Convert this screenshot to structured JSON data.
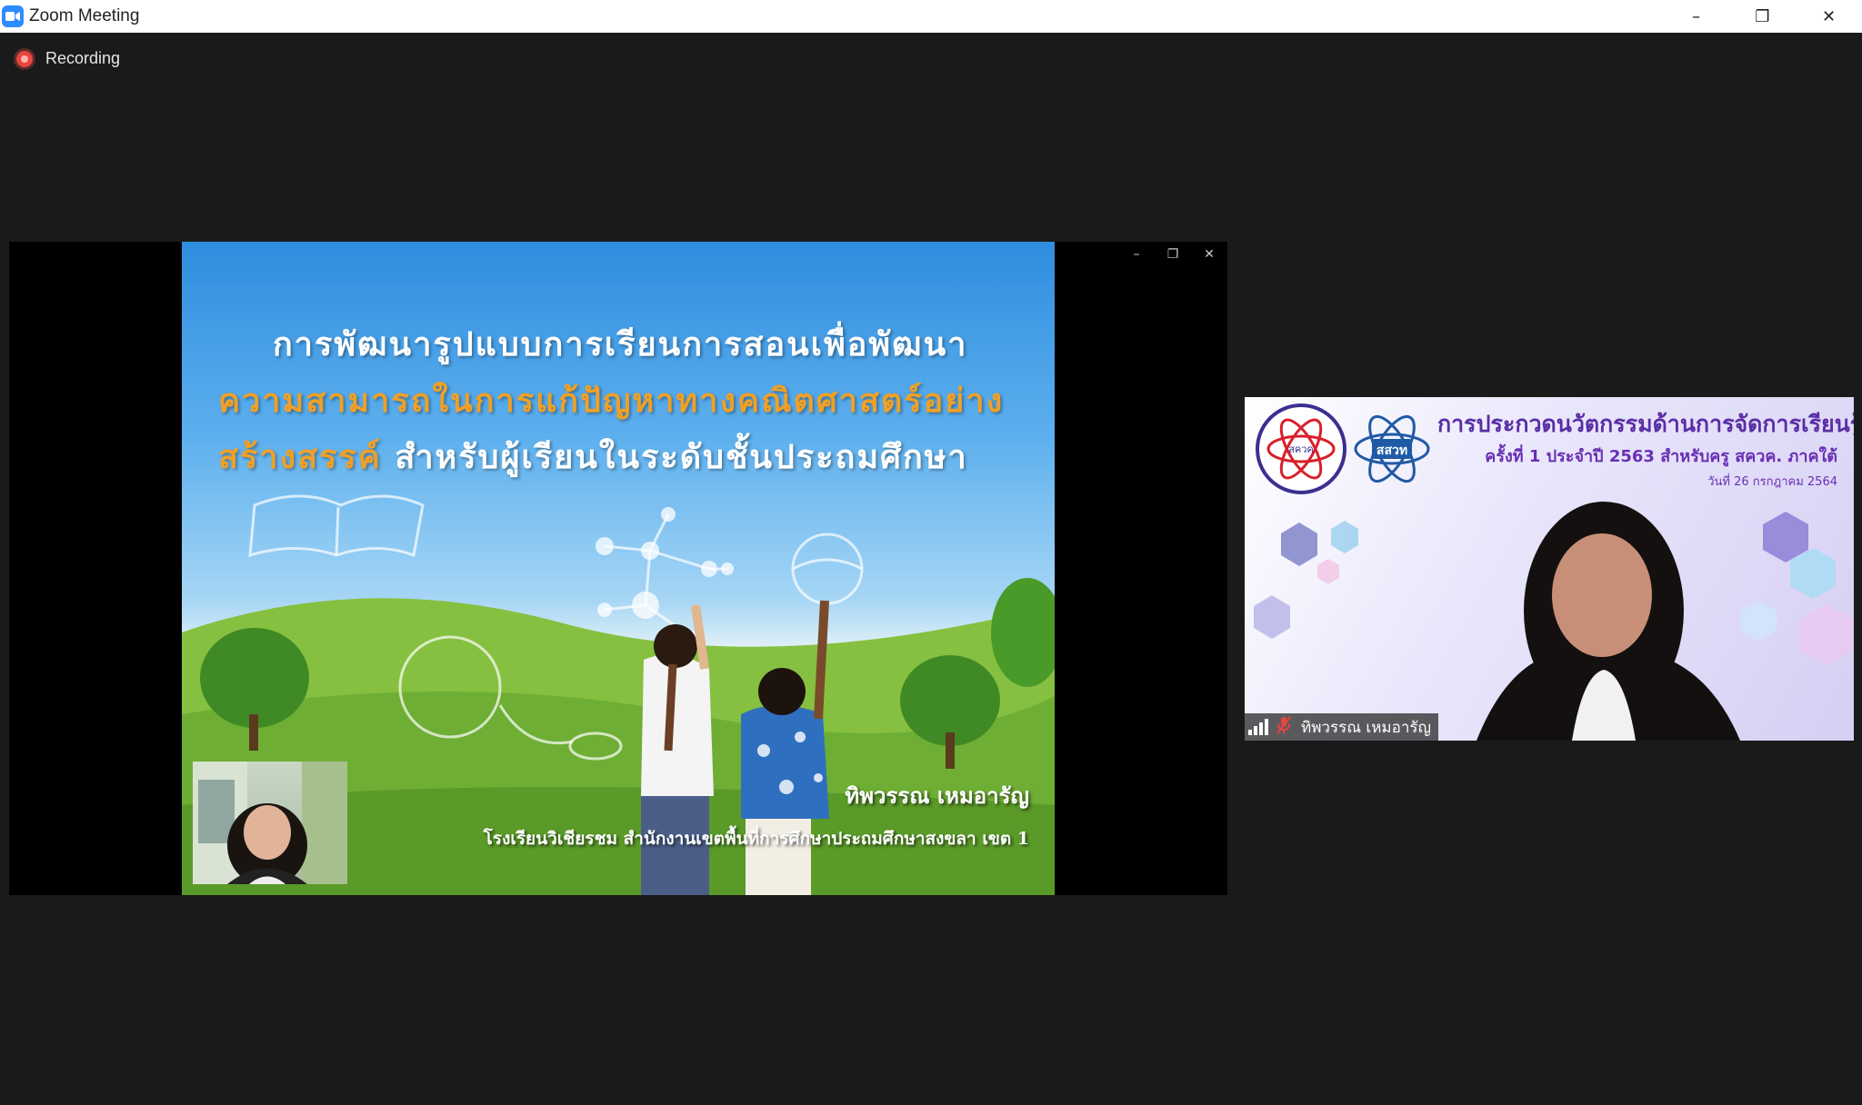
{
  "window": {
    "title": "Zoom Meeting",
    "controls": {
      "minimize": "–",
      "restore": "❐",
      "close": "✕"
    }
  },
  "recording": {
    "label": "Recording"
  },
  "share": {
    "controls": {
      "minimize": "–",
      "restore": "❐",
      "close": "✕"
    },
    "slide": {
      "title_line1": "การพัฒนารูปแบบการเรียนการสอนเพื่อพัฒนา",
      "title_line2": "ความสามารถในการแก้ปัญหาทางคณิตศาสตร์อย่าง",
      "title_line3_highlight": "สร้างสรรค์",
      "title_line3_rest": " สำหรับผู้เรียนในระดับชั้นประถมศึกษา",
      "presenter": "ทิพวรรณ  เหมอารัญ",
      "school": "โรงเรียนวิเชียรชม   สำนักงานเขตพื้นที่การศึกษาประถมศึกษาสงขลา  เขต 1"
    }
  },
  "participant": {
    "banner_title": "การประกวดนวัตกรรมด้านการจัดการเรียนรู้",
    "banner_subtitle": "ครั้งที่ 1 ประจำปี 2563 สำหรับครู สควค. ภาคใต้",
    "banner_date": "วันที่ 26 กรกฎาคม 2564",
    "logo_left_text": "สควค",
    "logo_right_text": "สสวท",
    "name": "ทิพวรรณ  เหมอารัญ",
    "signal_icon": "signal-bars-icon",
    "mic_icon": "mic-muted-icon",
    "mic_color": "#e8453c"
  }
}
